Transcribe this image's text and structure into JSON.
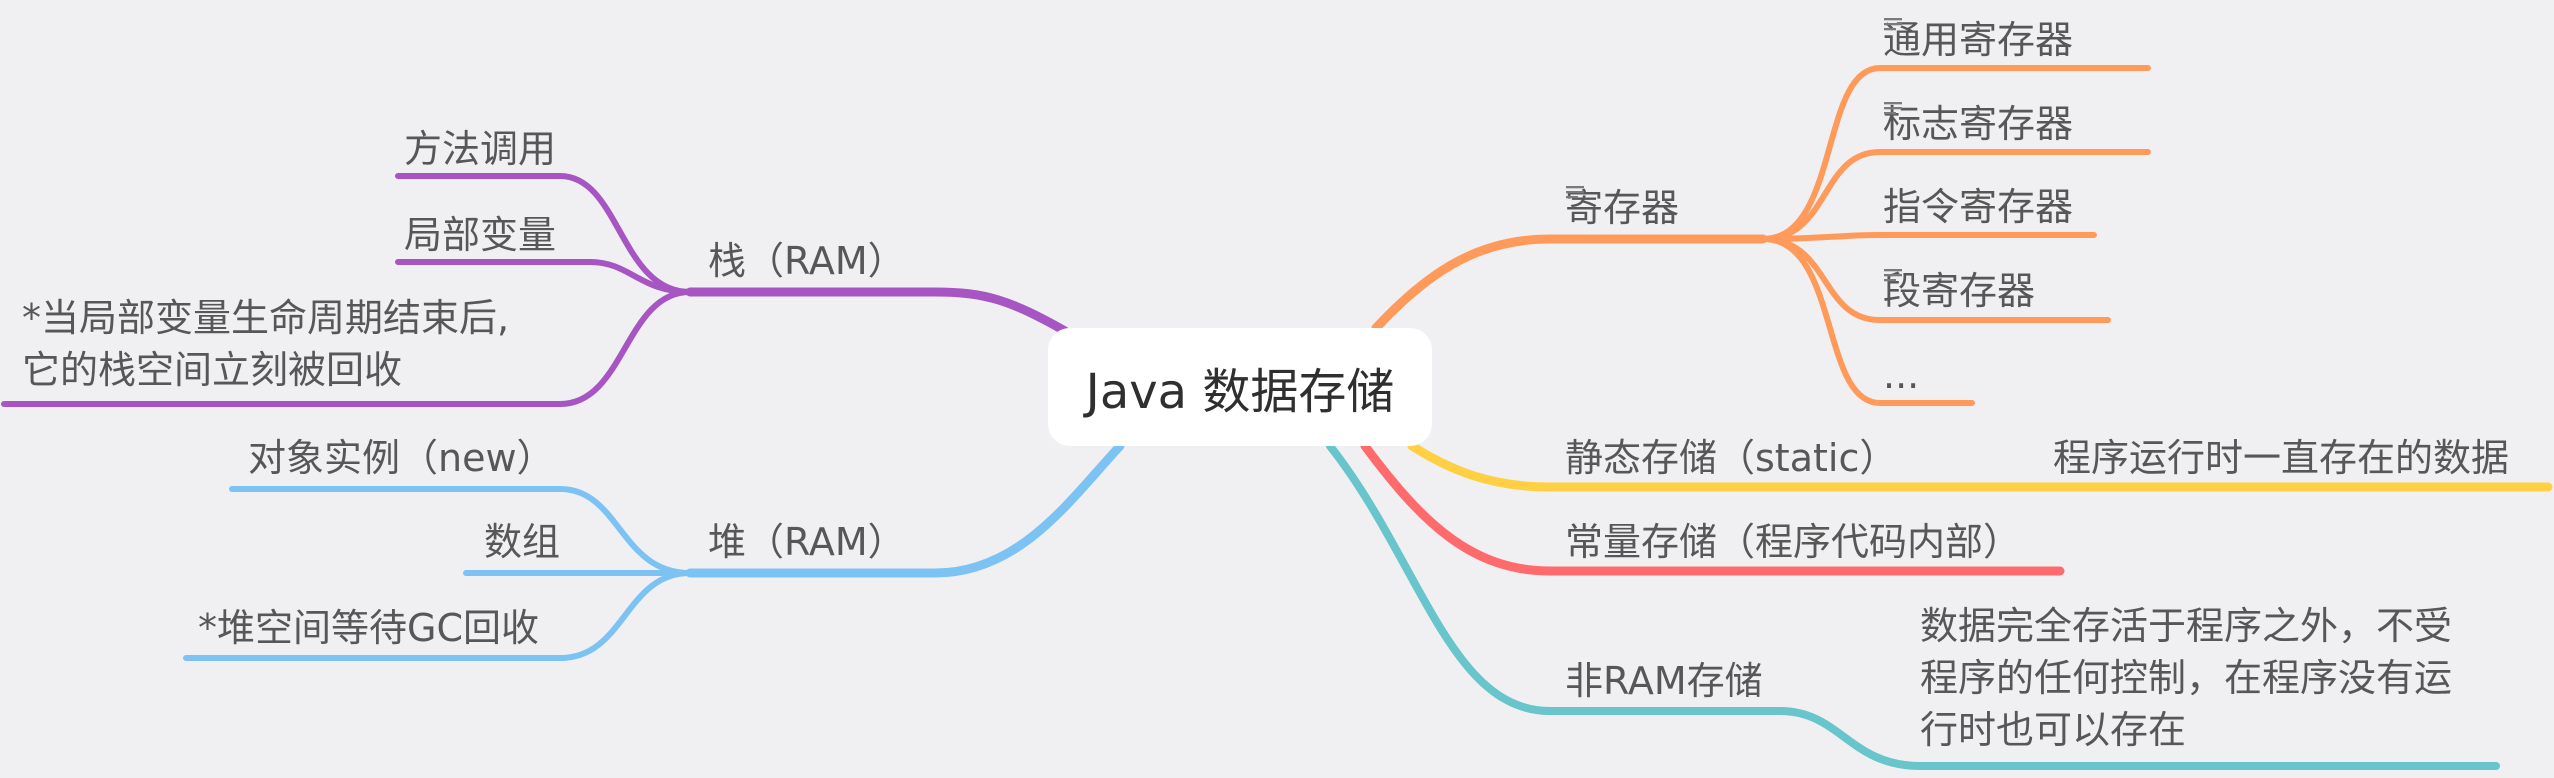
{
  "title": "Java 数据存储",
  "colors": {
    "stack": "#a855c4",
    "heap": "#7cc3f4",
    "register": "#ff9a5a",
    "static": "#ffcf44",
    "constant": "#ff6a6d",
    "nonram": "#67c5cb"
  },
  "left": {
    "stack": {
      "label": "栈（RAM）",
      "children": [
        "方法调用",
        "局部变量",
        "*当局部变量生命周期结束后,\n它的栈空间立刻被回收"
      ]
    },
    "heap": {
      "label": "堆（RAM）",
      "children": [
        "对象实例（new）",
        "数组",
        "*堆空间等待GC回收"
      ]
    }
  },
  "right": {
    "register": {
      "label": "寄存器",
      "has_note": true,
      "children": [
        {
          "label": "通用寄存器",
          "has_note": true
        },
        {
          "label": "标志寄存器",
          "has_note": true
        },
        {
          "label": "指令寄存器",
          "has_note": false
        },
        {
          "label": "段寄存器",
          "has_note": true
        },
        {
          "label": "...",
          "has_note": false
        }
      ]
    },
    "static": {
      "label": "静态存储（static）",
      "child": "程序运行时一直存在的数据"
    },
    "constant": {
      "label": "常量存储（程序代码内部）"
    },
    "nonram": {
      "label": "非RAM存储",
      "child": "数据完全存活于程序之外，不受程序的任何控制，在程序没有运行时也可以存在"
    }
  }
}
